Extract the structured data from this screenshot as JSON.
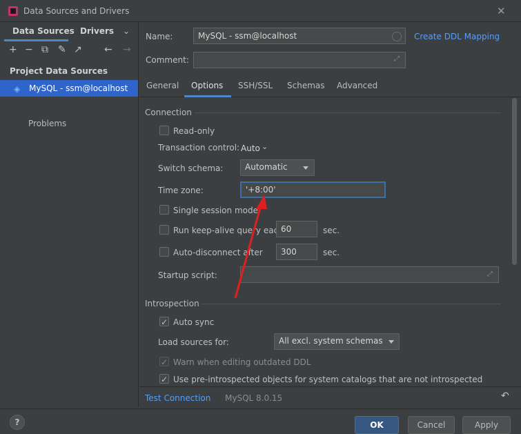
{
  "window": {
    "title": "Data Sources and Drivers",
    "close_icon": "close-icon"
  },
  "left": {
    "tabs": [
      "Data Sources",
      "Drivers"
    ],
    "dropdown_icon": "chevron-down-icon",
    "toolbar_icons": [
      "add-icon",
      "remove-icon",
      "copy-icon",
      "wrench-icon",
      "export-icon",
      "back-icon",
      "forward-icon"
    ],
    "section_title": "Project Data Sources",
    "selected_item": "MySQL - ssm@localhost",
    "problems_label": "Problems"
  },
  "form": {
    "name_label": "Name:",
    "name_value": "MySQL - ssm@localhost",
    "create_ddl_link": "Create DDL Mapping",
    "comment_label": "Comment:",
    "comment_value": ""
  },
  "tabs": {
    "items": [
      "General",
      "Options",
      "SSH/SSL",
      "Schemas",
      "Advanced"
    ],
    "active": "Options"
  },
  "connection": {
    "title": "Connection",
    "read_only": "Read-only",
    "transaction_control_label": "Transaction control:",
    "transaction_control_value": "Auto",
    "switch_schema_label": "Switch schema:",
    "switch_schema_value": "Automatic",
    "time_zone_label": "Time zone:",
    "time_zone_value": "'+8:00'",
    "single_session": "Single session mode",
    "keep_alive_label": "Run keep-alive query each",
    "keep_alive_value": "60",
    "keep_alive_unit": "sec.",
    "auto_disconnect_label": "Auto-disconnect after",
    "auto_disconnect_value": "300",
    "auto_disconnect_unit": "sec.",
    "startup_script_label": "Startup script:"
  },
  "introspection": {
    "title": "Introspection",
    "auto_sync": "Auto sync",
    "load_sources_label": "Load sources for:",
    "load_sources_value": "All excl. system schemas",
    "warn_label": "Warn when editing outdated DDL",
    "preintrospected_label": "Use pre-introspected objects for system catalogs that are not introspected"
  },
  "bottom": {
    "test_connection": "Test Connection",
    "driver_version": "MySQL 8.0.15",
    "revert_icon": "undo-icon"
  },
  "footer": {
    "help_icon": "help-icon",
    "ok_button": "OK",
    "cancel_button": "Cancel",
    "apply_button": "Apply"
  },
  "colors": {
    "accent": "#2f65ca",
    "link": "#589df6",
    "annotation_arrow": "#e02020"
  }
}
